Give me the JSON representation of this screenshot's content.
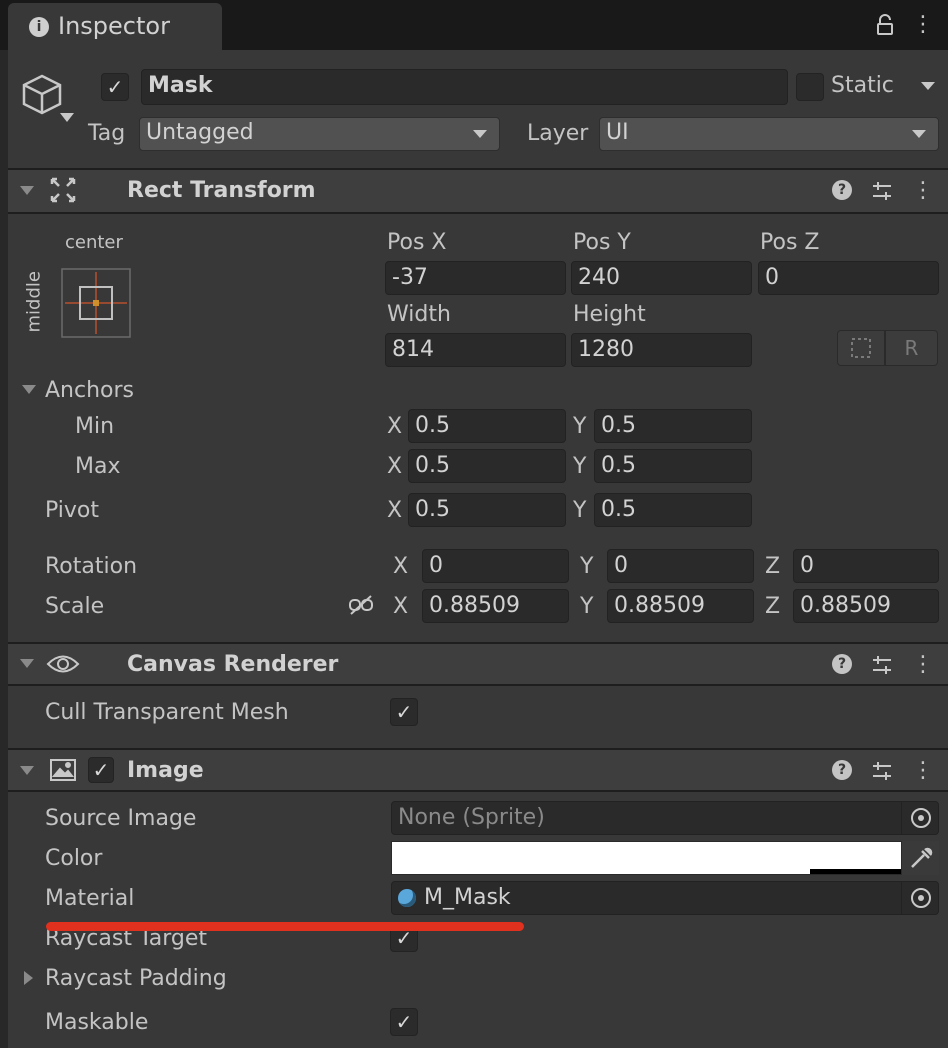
{
  "window": {
    "tab_label": "Inspector"
  },
  "gameobject": {
    "name": "Mask",
    "static_label": "Static",
    "tag_label": "Tag",
    "tag_value": "Untagged",
    "layer_label": "Layer",
    "layer_value": "UI"
  },
  "rect_transform": {
    "title": "Rect Transform",
    "anchor_preset_top": "center",
    "anchor_preset_side": "middle",
    "pos_x_label": "Pos X",
    "pos_y_label": "Pos Y",
    "pos_z_label": "Pos Z",
    "pos_x": "-37",
    "pos_y": "240",
    "pos_z": "0",
    "width_label": "Width",
    "height_label": "Height",
    "width": "814",
    "height": "1280",
    "r_button": "R",
    "anchors_label": "Anchors",
    "min_label": "Min",
    "max_label": "Max",
    "pivot_label": "Pivot",
    "x": "X",
    "y": "Y",
    "z": "Z",
    "min_x": "0.5",
    "min_y": "0.5",
    "max_x": "0.5",
    "max_y": "0.5",
    "pivot_x": "0.5",
    "pivot_y": "0.5",
    "rotation_label": "Rotation",
    "rot_x": "0",
    "rot_y": "0",
    "rot_z": "0",
    "scale_label": "Scale",
    "scale_x": "0.88509",
    "scale_y": "0.88509",
    "scale_z": "0.88509"
  },
  "canvas_renderer": {
    "title": "Canvas Renderer",
    "cull_label": "Cull Transparent Mesh"
  },
  "image": {
    "title": "Image",
    "source_label": "Source Image",
    "source_value": "None (Sprite)",
    "color_label": "Color",
    "material_label": "Material",
    "material_value": "M_Mask",
    "raycast_target_label": "Raycast Target",
    "raycast_padding_label": "Raycast Padding",
    "maskable_label": "Maskable"
  },
  "colors": {
    "annotation": "#e0301e",
    "material_icon": "#5aa7dc"
  }
}
